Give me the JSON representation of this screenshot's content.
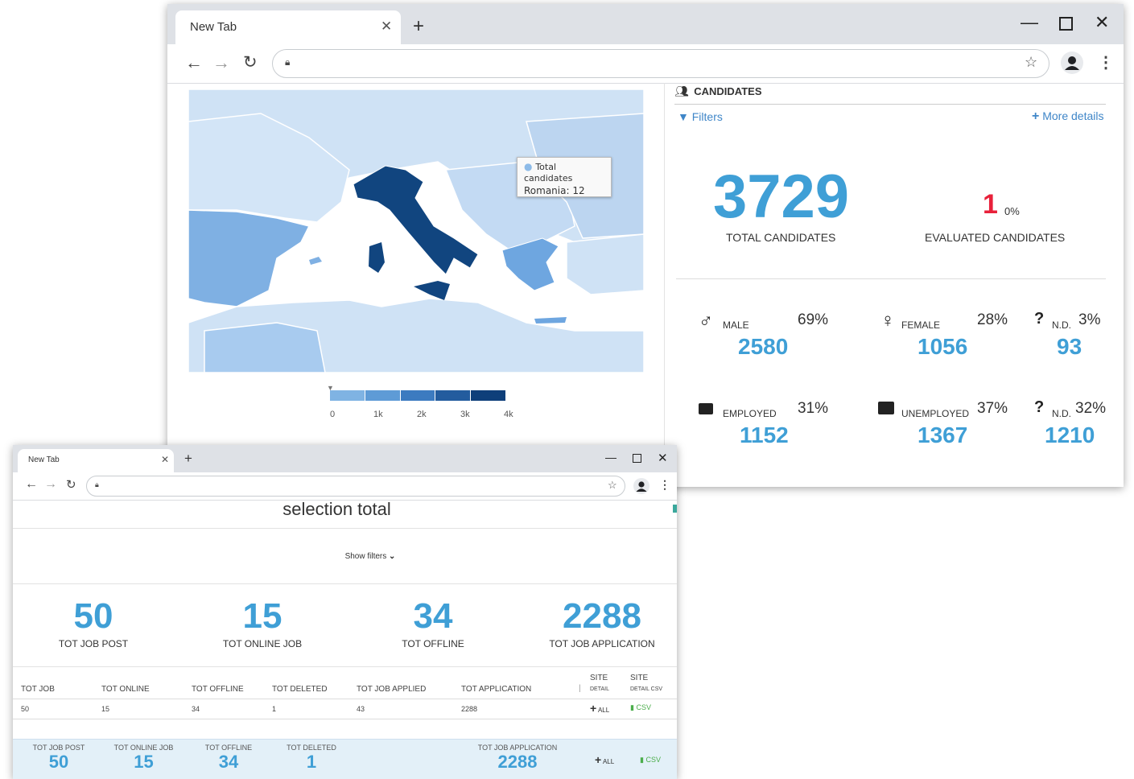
{
  "window1": {
    "tab_title": "New Tab",
    "candidates_header": "CANDIDATES",
    "filters_label": "Filters",
    "more_details_label": "More details",
    "total_candidates_value": "3729",
    "total_candidates_label": "TOTAL CANDIDATES",
    "evaluated_value": "1",
    "evaluated_pct": "0%",
    "evaluated_label": "EVALUATED CANDIDATES",
    "tooltip": {
      "series": "Total candidates",
      "text": "Romania: 12"
    },
    "legend_ticks": [
      "0",
      "1k",
      "2k",
      "3k",
      "4k"
    ],
    "legend_colors": [
      "#7fb3e3",
      "#5e9bd6",
      "#3c7bc0",
      "#235c9e",
      "#0e3f7a"
    ],
    "map_colors": {
      "sea": "#ffffff",
      "light": "#cfe2f5",
      "mid": "#8dbbe8",
      "dark": "#11457f",
      "land_bg": "#dbe9f8"
    },
    "stats": {
      "male": {
        "label": "MALE",
        "pct": "69%",
        "value": "2580"
      },
      "female": {
        "label": "FEMALE",
        "pct": "28%",
        "value": "1056"
      },
      "nd_gender": {
        "label": "N.D.",
        "pct": "3%",
        "value": "93"
      },
      "employed": {
        "label": "EMPLOYED",
        "pct": "31%",
        "value": "1152"
      },
      "unemployed": {
        "label": "UNEMPLOYED",
        "pct": "37%",
        "value": "1367"
      },
      "nd_work": {
        "label": "N.D.",
        "pct": "32%",
        "value": "1210"
      }
    }
  },
  "window2": {
    "tab_title": "New Tab",
    "page_title": "selection total",
    "show_filters": "Show filters",
    "kpis": [
      {
        "value": "50",
        "label": "TOT JOB POST"
      },
      {
        "value": "15",
        "label": "TOT ONLINE JOB"
      },
      {
        "value": "34",
        "label": "TOT OFFLINE"
      },
      {
        "value": "2288",
        "label": "TOT JOB APPLICATION"
      }
    ],
    "table": {
      "headers": [
        "TOT JOB",
        "TOT ONLINE",
        "TOT OFFLINE",
        "TOT DELETED",
        "TOT JOB APPLIED",
        "TOT APPLICATION"
      ],
      "site_detail_label": "SITE",
      "site_detail_sub": "DETAIL",
      "site_csv_label": "SITE",
      "site_csv_sub": "DETAIL CSV",
      "row": [
        "50",
        "15",
        "34",
        "1",
        "43",
        "2288"
      ],
      "all_label": "ALL",
      "csv_label": "CSV"
    },
    "footer": {
      "items": [
        {
          "label": "TOT JOB POST",
          "value": "50"
        },
        {
          "label": "TOT ONLINE JOB",
          "value": "15"
        },
        {
          "label": "TOT OFFLINE",
          "value": "34"
        },
        {
          "label": "TOT DELETED",
          "value": "1"
        },
        {
          "label": "TOT JOB APPLICATION",
          "value": "2288"
        }
      ],
      "all_label": "ALL",
      "csv_label": "CSV"
    }
  }
}
